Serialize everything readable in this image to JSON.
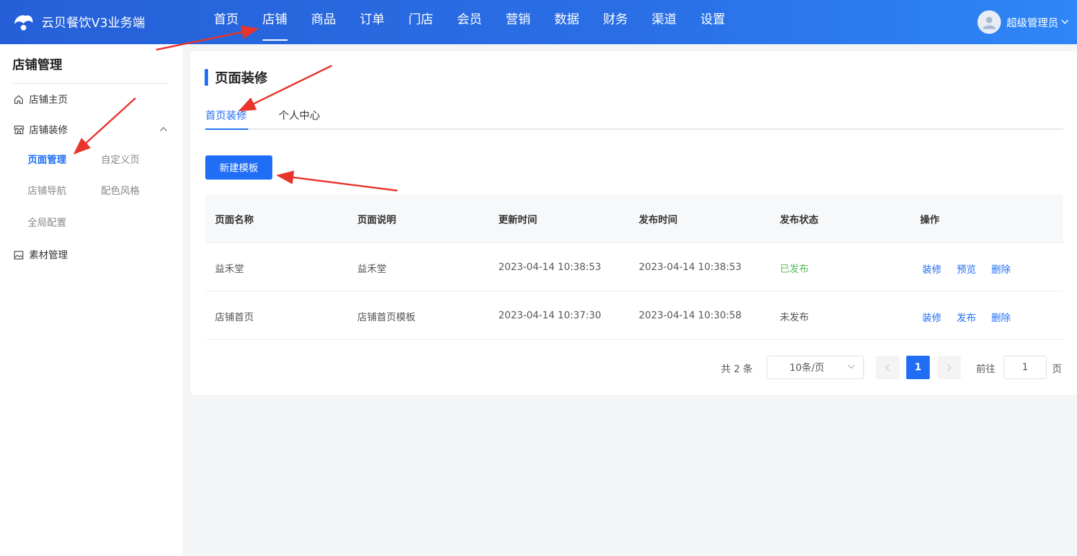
{
  "app": {
    "title": "云贝餐饮V3业务端"
  },
  "topnav": {
    "items": [
      {
        "label": "首页"
      },
      {
        "label": "店铺"
      },
      {
        "label": "商品"
      },
      {
        "label": "订单"
      },
      {
        "label": "门店"
      },
      {
        "label": "会员"
      },
      {
        "label": "营销"
      },
      {
        "label": "数据"
      },
      {
        "label": "财务"
      },
      {
        "label": "渠道"
      },
      {
        "label": "设置"
      }
    ],
    "active": "店铺"
  },
  "user": {
    "name": "超级管理员",
    "caret_icon": "chevron-down-icon",
    "avatar_icon": "user-icon"
  },
  "sidebar": {
    "title": "店铺管理",
    "items": [
      {
        "label": "店铺主页",
        "icon": "home-icon"
      },
      {
        "label": "店铺装修",
        "icon": "store-icon",
        "expanded": true
      },
      {
        "label": "素材管理",
        "icon": "image-icon"
      }
    ],
    "sub_items": [
      {
        "label": "页面管理",
        "active": true
      },
      {
        "label": "自定义页"
      },
      {
        "label": "店铺导航"
      },
      {
        "label": "配色风格"
      },
      {
        "label": "全局配置"
      }
    ]
  },
  "main": {
    "heading": "页面装修",
    "tabs": [
      {
        "label": "首页装修",
        "active": true
      },
      {
        "label": "个人中心"
      }
    ],
    "new_button": "新建模板",
    "table": {
      "columns": [
        "页面名称",
        "页面说明",
        "更新时间",
        "发布时间",
        "发布状态",
        "操作"
      ],
      "rows": [
        {
          "name": "益禾堂",
          "desc": "益禾堂",
          "updated": "2023-04-14 10:38:53",
          "published_at": "2023-04-14 10:38:53",
          "status": "已发布",
          "ops": [
            "装修",
            "预览",
            "删除"
          ]
        },
        {
          "name": "店铺首页",
          "desc": "店铺首页模板",
          "updated": "2023-04-14 10:37:30",
          "published_at": "2023-04-14 10:30:58",
          "status": "未发布",
          "ops": [
            "装修",
            "发布",
            "删除"
          ]
        }
      ]
    },
    "pagination": {
      "total_text": "共 2 条",
      "page_size": "10条/页",
      "current_page": "1",
      "goto_label": "前往",
      "goto_value": "1",
      "goto_unit": "页"
    }
  },
  "colors": {
    "primary": "#1f6ef5",
    "published": "#5cb85c",
    "annotation_arrow": "#e8342a"
  }
}
